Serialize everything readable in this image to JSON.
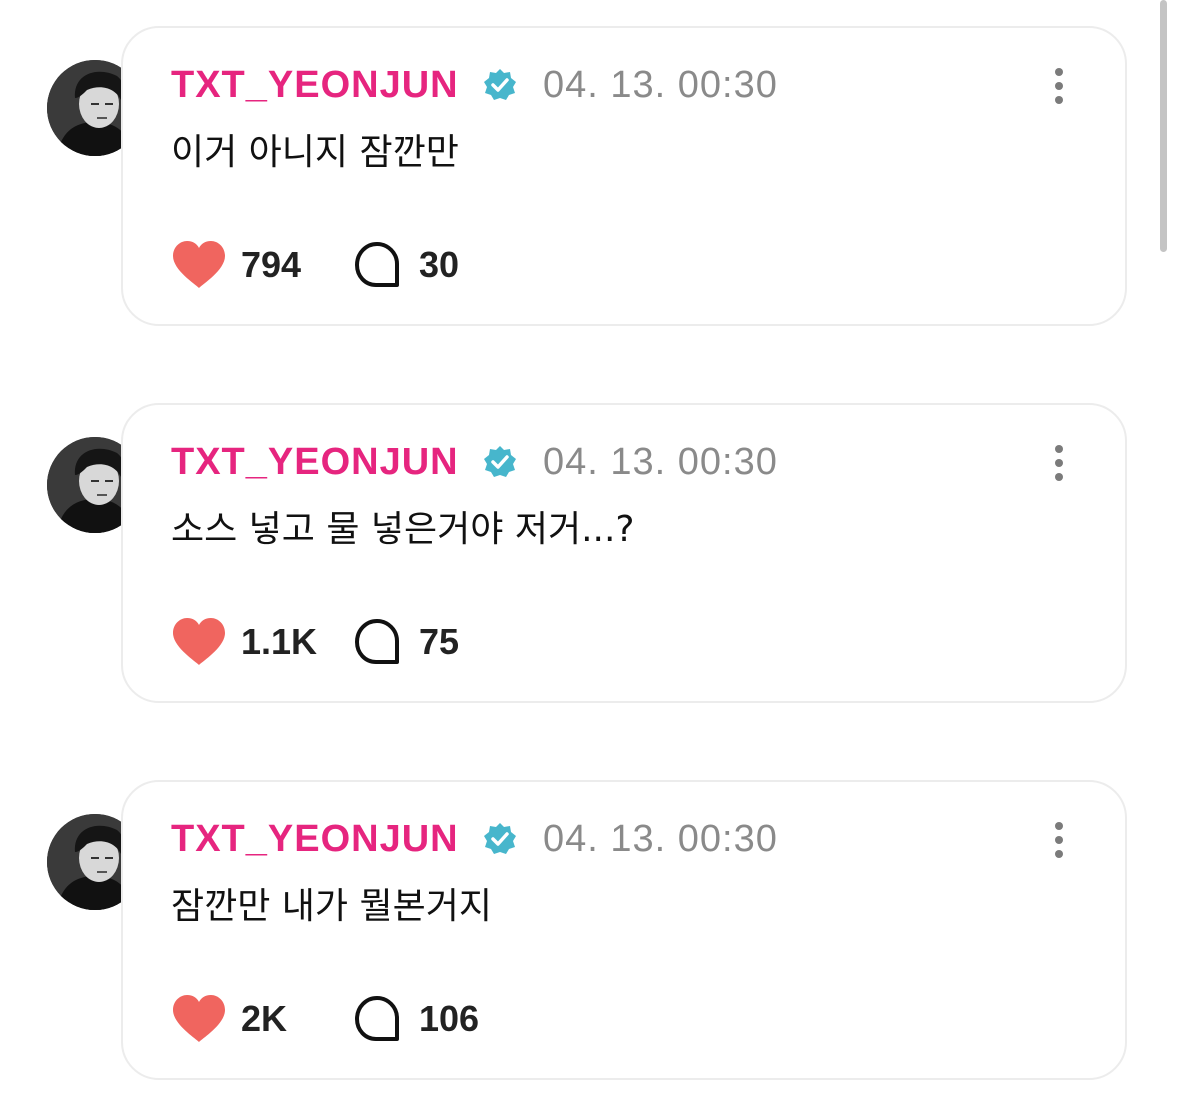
{
  "colors": {
    "username": "#e6257f",
    "verified_badge": "#47b6cc",
    "heart": "#f0655f",
    "timestamp": "#8a8a8a"
  },
  "posts": [
    {
      "username": "TXT_YEONJUN",
      "timestamp": "04. 13. 00:30",
      "text": "이거 아니지 잠깐만",
      "likes": "794",
      "comments": "30",
      "icons": [
        "avatar",
        "verified-badge-icon",
        "more-options-icon",
        "heart-icon",
        "comment-icon"
      ]
    },
    {
      "username": "TXT_YEONJUN",
      "timestamp": "04. 13. 00:30",
      "text": "소스 넣고 물 넣은거야 저거...?",
      "likes": "1.1K",
      "comments": "75",
      "icons": [
        "avatar",
        "verified-badge-icon",
        "more-options-icon",
        "heart-icon",
        "comment-icon"
      ]
    },
    {
      "username": "TXT_YEONJUN",
      "timestamp": "04. 13. 00:30",
      "text": "잠깐만 내가 뭘본거지",
      "likes": "2K",
      "comments": "106",
      "icons": [
        "avatar",
        "verified-badge-icon",
        "more-options-icon",
        "heart-icon",
        "comment-icon"
      ]
    }
  ]
}
